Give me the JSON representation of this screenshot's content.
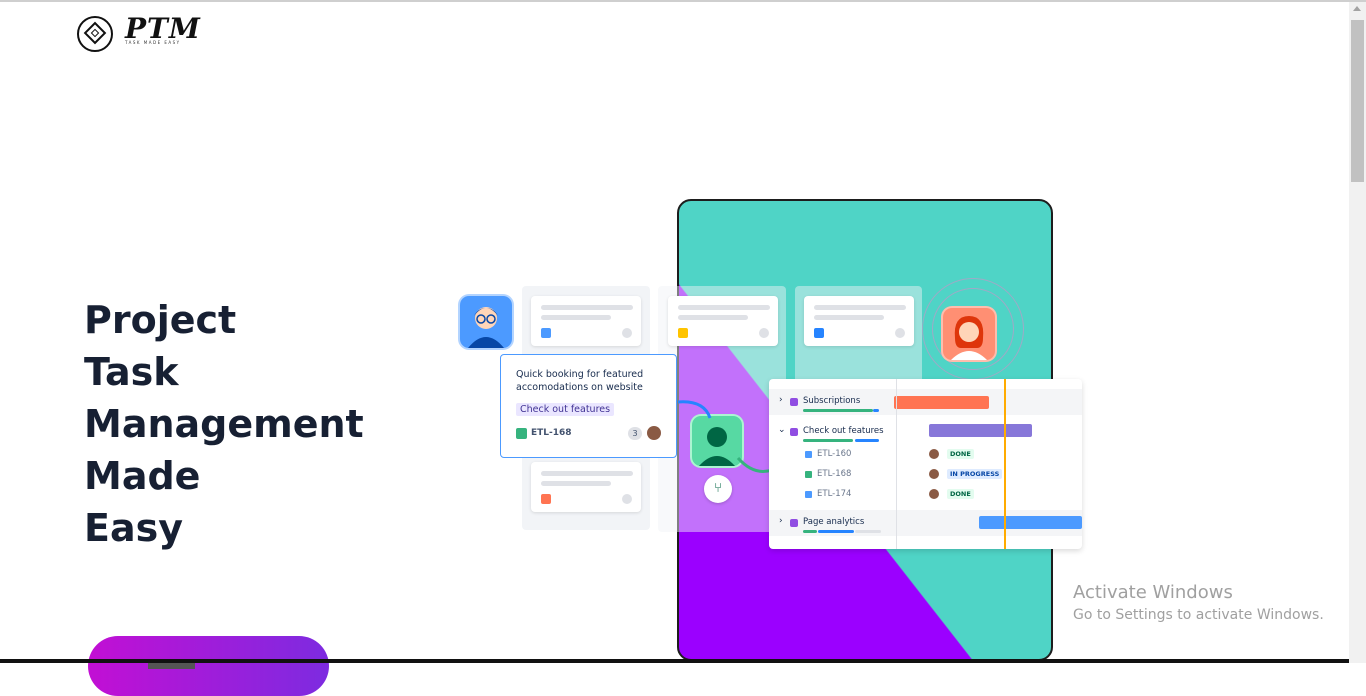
{
  "brand": {
    "logo_text": "PTM",
    "tagline": "TASK MADE EASY"
  },
  "hero": {
    "lines": [
      "Project",
      "Task",
      "Management",
      "Made",
      "Easy"
    ]
  },
  "illustration": {
    "popup": {
      "title_line1": "Quick booking for featured",
      "title_line2": "accomodations on website",
      "chip": "Check out features",
      "key": "ETL-168",
      "count": "3"
    },
    "timeline": {
      "rows": [
        {
          "label": "Subscriptions"
        },
        {
          "label": "Check out features"
        },
        {
          "label": "ETL-160",
          "status": "DONE"
        },
        {
          "label": "ETL-168",
          "status": "IN PROGRESS"
        },
        {
          "label": "ETL-174",
          "status": "DONE"
        },
        {
          "label": "Page analytics"
        }
      ]
    }
  },
  "watermark": {
    "title": "Activate Windows",
    "subtitle": "Go to Settings to activate Windows."
  },
  "colors": {
    "accent_start": "#c20fd4",
    "accent_end": "#7d2be0",
    "teal": "#4fd4c6",
    "purple": "#9b00ff"
  }
}
